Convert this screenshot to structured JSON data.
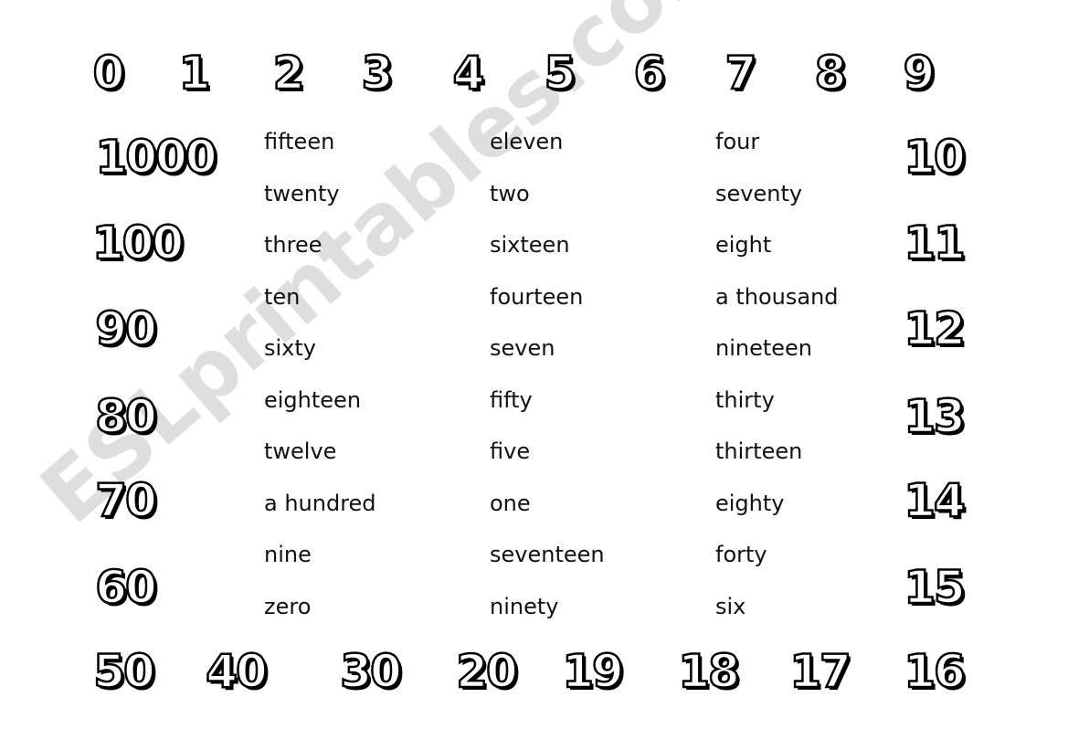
{
  "top_numbers": [
    "0",
    "1",
    "2",
    "3",
    "4",
    "5",
    "6",
    "7",
    "8",
    "9"
  ],
  "left_numbers": [
    "1000",
    "100",
    "90",
    "80",
    "70",
    "60"
  ],
  "right_numbers": [
    "10",
    "11",
    "12",
    "13",
    "14",
    "15"
  ],
  "bottom_numbers": [
    "50",
    "40",
    "30",
    "20",
    "19",
    "18",
    "17",
    "16"
  ],
  "word_columns": [
    [
      "fifteen",
      "twenty",
      "three",
      "ten",
      "sixty",
      "eighteen",
      "twelve",
      "a hundred",
      "nine",
      "zero"
    ],
    [
      "eleven",
      "two",
      "sixteen",
      "fourteen",
      "seven",
      "fifty",
      "five",
      "one",
      "seventeen",
      "ninety"
    ],
    [
      "four",
      "seventy",
      "eight",
      "a thousand",
      "nineteen",
      "thirty",
      "thirteen",
      "eighty",
      "forty",
      "six"
    ]
  ],
  "watermark": "ESLprintables.com"
}
